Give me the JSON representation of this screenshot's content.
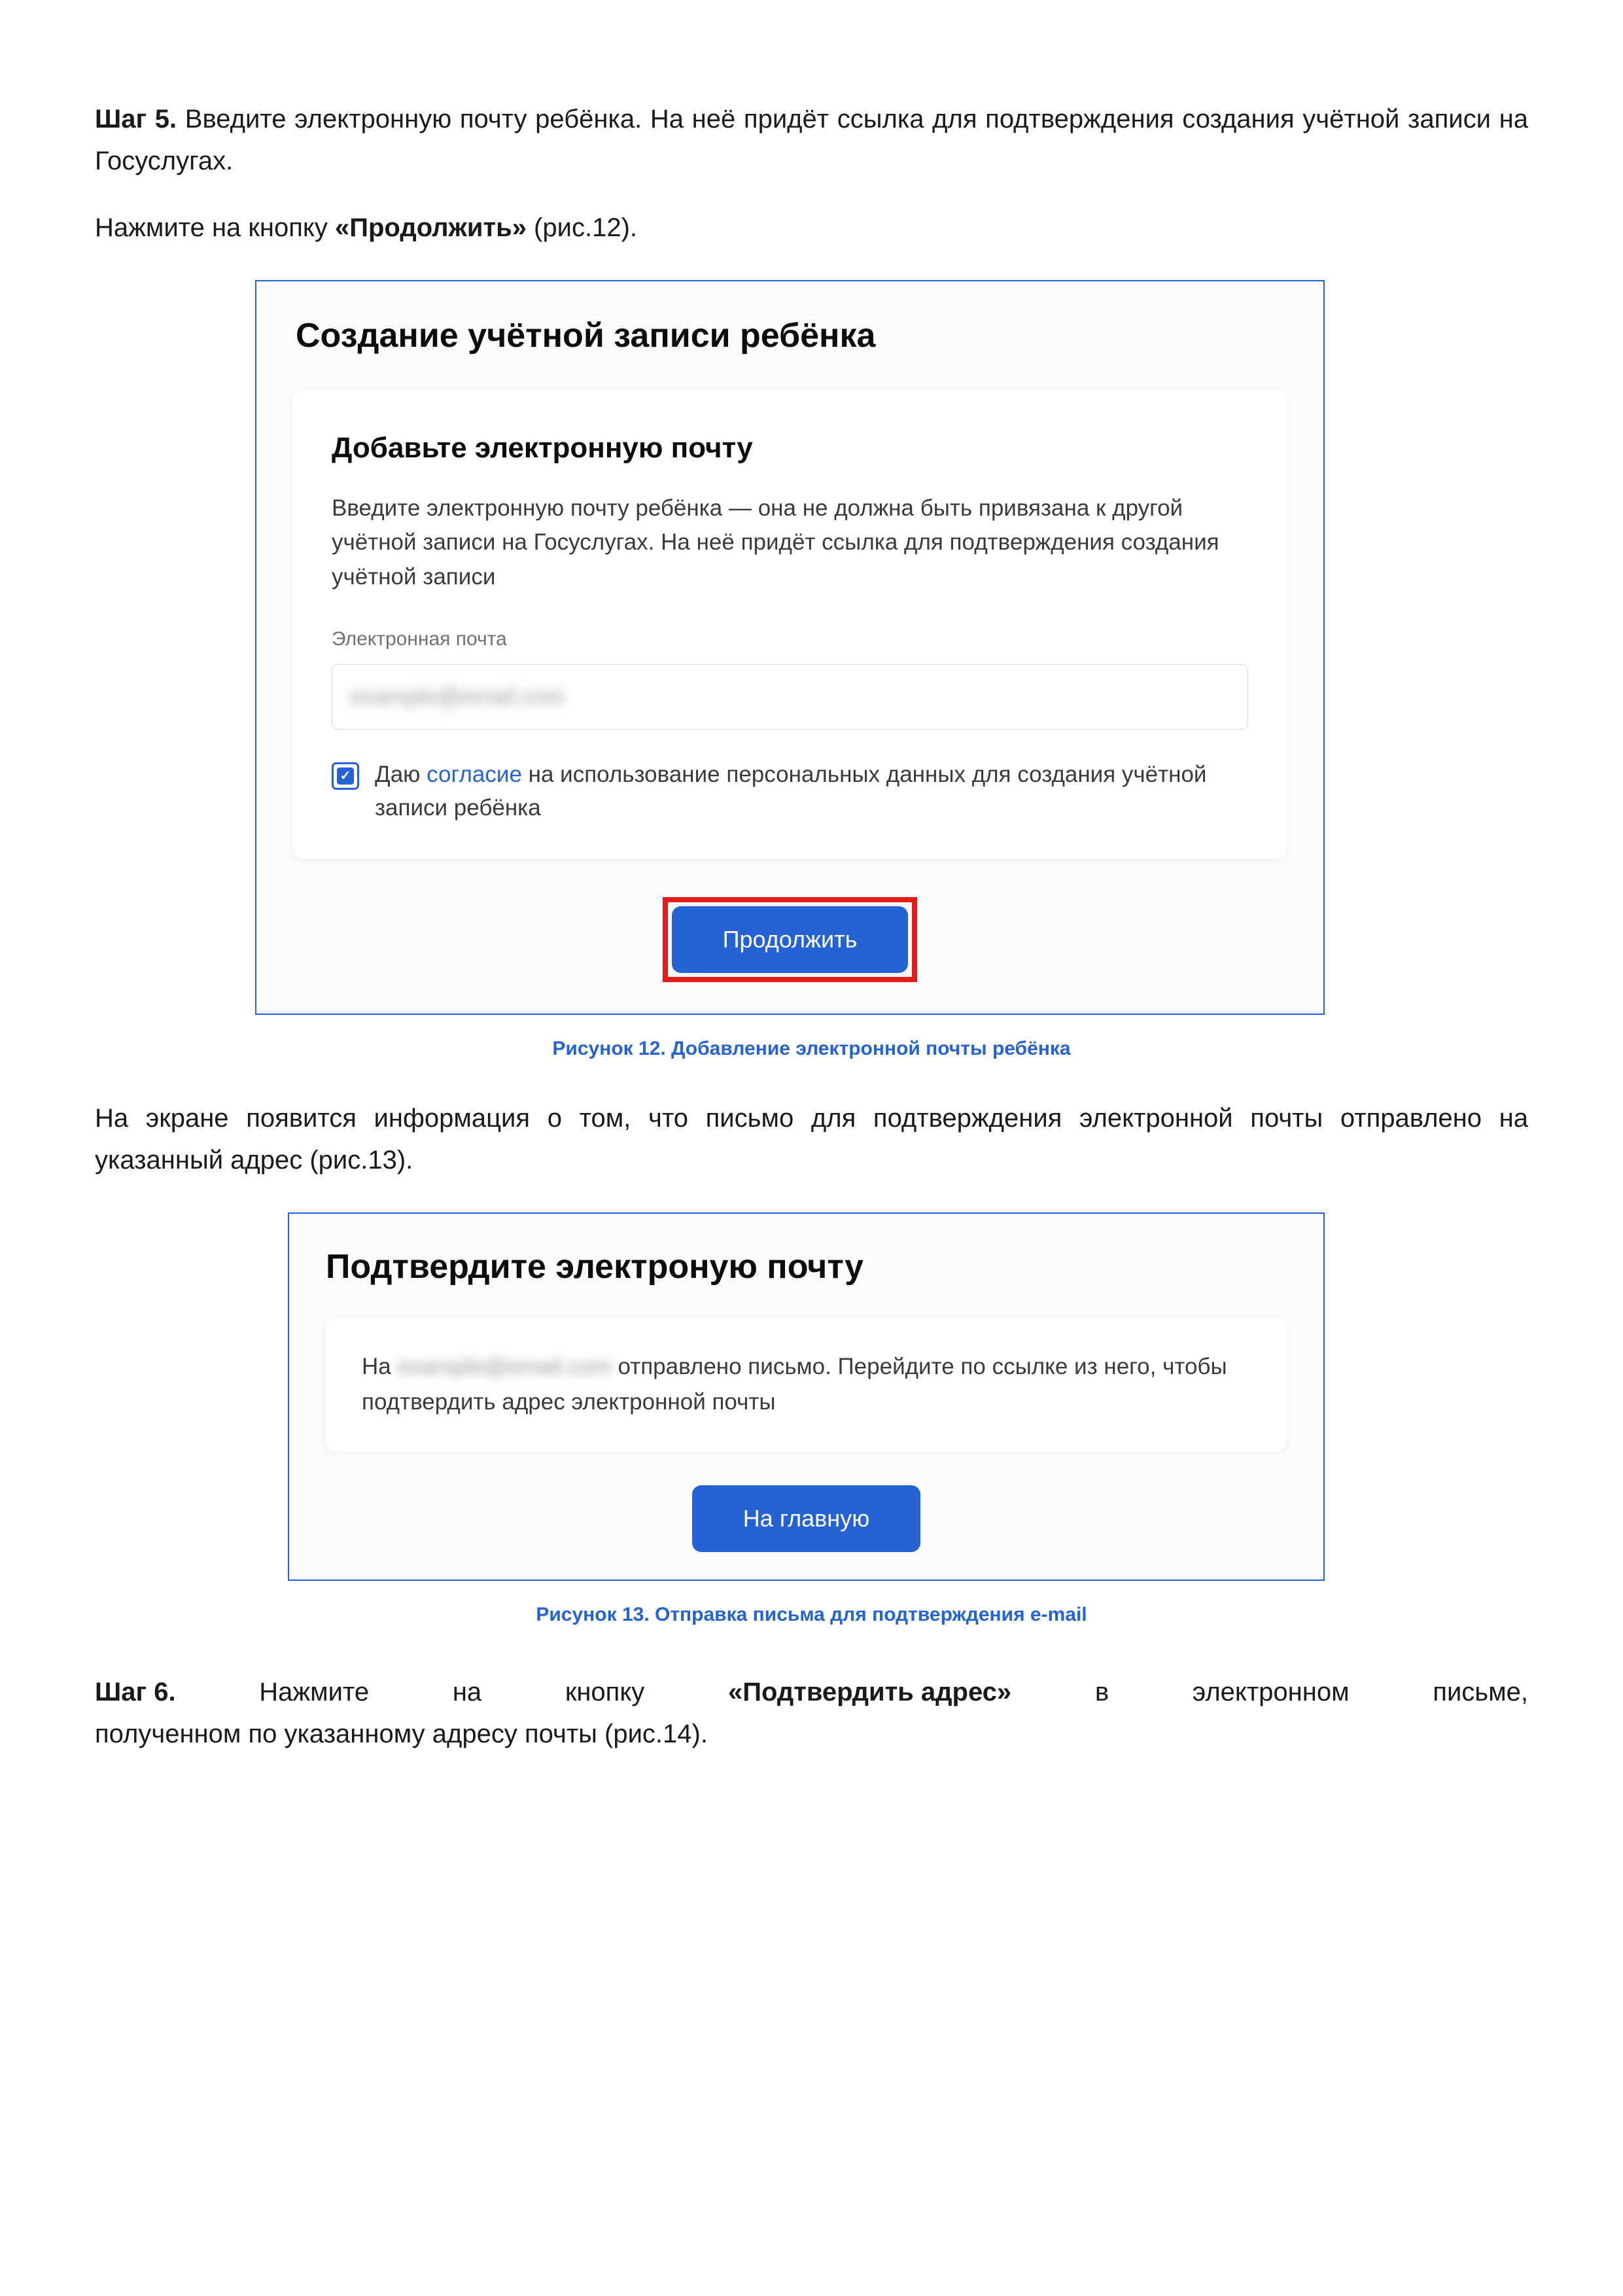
{
  "step5": {
    "label": "Шаг 5.",
    "text_after": " Введите электронную почту ребёнка. На неё придёт ссылка для подтверждения создания учётной записи на Госуслугах."
  },
  "instruction_continue": {
    "prefix": "Нажмите на кнопку ",
    "bold": "«Продолжить»",
    "suffix": " (рис.12)."
  },
  "figure12": {
    "title": "Создание учётной записи ребёнка",
    "card": {
      "section_title": "Добавьте электронную почту",
      "description": "Введите электронную почту ребёнка — она не должна быть привязана к другой учётной записи на Госуслугах. На неё придёт ссылка для подтверждения создания учётной записи",
      "input_label": "Электронная почта",
      "input_blurred": "example@email.com",
      "consent_prefix": "Даю ",
      "consent_link": "согласие",
      "consent_suffix": " на использование персональных данных для создания учётной записи ребёнка",
      "button": "Продолжить"
    },
    "caption": "Рисунок 12. Добавление электронной почты ребёнка"
  },
  "mid_paragraph": "На экране появится информация о том, что письмо для подтверждения электронной почты отправлено на указанный адрес (рис.13).",
  "figure13": {
    "title": "Подтвердите электроную почту",
    "card": {
      "text_prefix": "На ",
      "blurred": "example@email.com",
      "text_middle": " отправлено письмо. Перейдите по ссылке из него, чтобы подтвердить адрес электронной почты",
      "button": "На главную"
    },
    "caption": "Рисунок 13. Отправка письма для подтверждения e-mail"
  },
  "step6": {
    "label": "Шаг 6.",
    "w1": "Нажмите",
    "w2": "на",
    "w3": "кнопку",
    "bold": "«Подтвердить адрес»",
    "w4": "в",
    "w5": "электронном",
    "w6": "письме,",
    "line2": "полученном по указанному адресу почты (рис.14)."
  }
}
